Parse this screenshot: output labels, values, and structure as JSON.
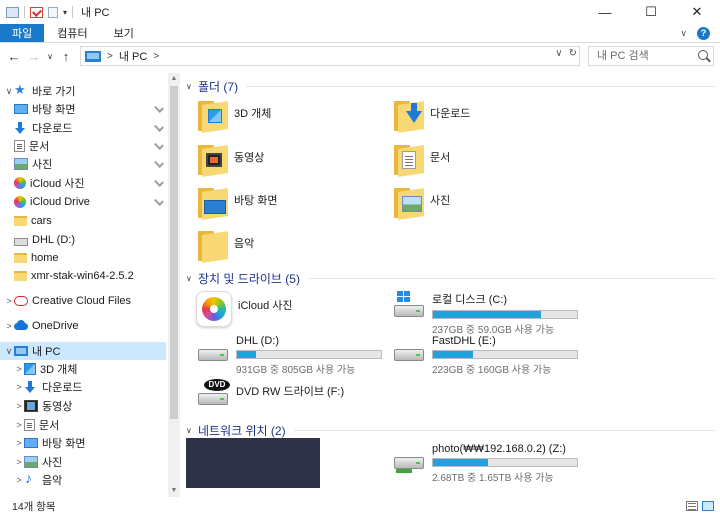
{
  "window": {
    "title": "내 PC"
  },
  "ribbon": {
    "tabs": [
      "파일",
      "컴퓨터",
      "보기"
    ]
  },
  "address": {
    "location": "내 PC",
    "sep": ">",
    "chevron": ">"
  },
  "search": {
    "placeholder": "내 PC 검색"
  },
  "nav": {
    "items": [
      {
        "label": "바로 가기",
        "icon": "star-icon",
        "level": 0,
        "chevron": "∨"
      },
      {
        "label": "바탕 화면",
        "icon": "desktop-icon",
        "level": 1,
        "pinned": true
      },
      {
        "label": "다운로드",
        "icon": "download-icon",
        "level": 1,
        "pinned": true
      },
      {
        "label": "문서",
        "icon": "document-icon",
        "level": 1,
        "pinned": true
      },
      {
        "label": "사진",
        "icon": "pictures-icon",
        "level": 1,
        "pinned": true
      },
      {
        "label": "iCloud 사진",
        "icon": "icloud-photos-icon",
        "level": 1,
        "pinned": true
      },
      {
        "label": "iCloud Drive",
        "icon": "icloud-drive-icon",
        "level": 1,
        "pinned": true
      },
      {
        "label": "cars",
        "icon": "folder-icon",
        "level": 1
      },
      {
        "label": "DHL (D:)",
        "icon": "drive-icon",
        "level": 1
      },
      {
        "label": "home",
        "icon": "folder-icon",
        "level": 1
      },
      {
        "label": "xmr-stak-win64-2.5.2",
        "icon": "folder-icon",
        "level": 1
      },
      {
        "label": "Creative Cloud Files",
        "icon": "creative-cloud-icon",
        "level": 0,
        "chevron": ">"
      },
      {
        "label": "OneDrive",
        "icon": "onedrive-icon",
        "level": 0,
        "chevron": ">"
      },
      {
        "label": "내 PC",
        "icon": "pc-icon",
        "level": 0,
        "chevron": "∨",
        "selected": true
      },
      {
        "label": "3D 개체",
        "icon": "3d-objects-icon",
        "level": 1,
        "chevron": ">"
      },
      {
        "label": "다운로드",
        "icon": "download-icon",
        "level": 1,
        "chevron": ">"
      },
      {
        "label": "동영상",
        "icon": "video-icon",
        "level": 1,
        "chevron": ">"
      },
      {
        "label": "문서",
        "icon": "document-icon",
        "level": 1,
        "chevron": ">"
      },
      {
        "label": "바탕 화면",
        "icon": "desktop-icon",
        "level": 1,
        "chevron": ">"
      },
      {
        "label": "사진",
        "icon": "pictures-icon",
        "level": 1,
        "chevron": ">"
      },
      {
        "label": "음악",
        "icon": "music-icon",
        "level": 1,
        "chevron": ">"
      }
    ]
  },
  "groups": {
    "folders": {
      "title": "폴더 (7)"
    },
    "devices": {
      "title": "장치 및 드라이브 (5)"
    },
    "network": {
      "title": "네트워크 위치 (2)"
    }
  },
  "folders": [
    {
      "name": "3D 개체",
      "overlay": "cube"
    },
    {
      "name": "다운로드",
      "overlay": "arrow"
    },
    {
      "name": "동영상",
      "overlay": "film"
    },
    {
      "name": "문서",
      "overlay": "page"
    },
    {
      "name": "바탕 화면",
      "overlay": "screen"
    },
    {
      "name": "사진",
      "overlay": "photo"
    },
    {
      "name": "음악",
      "overlay": "note"
    }
  ],
  "devices": [
    {
      "name": "iCloud 사진",
      "icon": "icloud-photos-icon"
    },
    {
      "name": "로컬 디스크 (C:)",
      "sub": "237GB 중 59.0GB 사용 가능",
      "used_fraction": 0.75,
      "icon": "windows-drive-icon"
    },
    {
      "name": "DHL (D:)",
      "sub": "931GB 중 805GB 사용 가능",
      "used_fraction": 0.135,
      "icon": "drive-icon"
    },
    {
      "name": "FastDHL (E:)",
      "sub": "223GB 중 160GB 사용 가능",
      "used_fraction": 0.28,
      "icon": "drive-icon"
    },
    {
      "name": "DVD RW 드라이브 (F:)",
      "icon": "dvd-drive-icon",
      "badge": "DVD"
    }
  ],
  "network": [
    {
      "name": "photo(₩₩192.168.0.2) (Z:)",
      "sub": "2.68TB 중 1.65TB 사용 가능",
      "used_fraction": 0.385,
      "icon": "network-drive-icon"
    }
  ],
  "status": {
    "count": "14개 항목"
  },
  "colors": {
    "accent": "#1979ca",
    "selection": "#cce8ff",
    "bar_fill": "#26a0da",
    "group_title": "#1e3287"
  }
}
